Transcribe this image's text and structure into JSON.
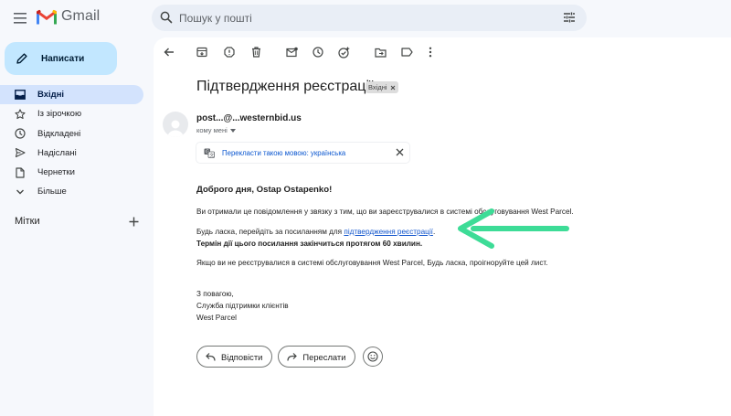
{
  "app": {
    "name": "Gmail"
  },
  "search": {
    "placeholder": "Пошук у пошті"
  },
  "compose": {
    "label": "Написати"
  },
  "sidebar": {
    "items": [
      {
        "label": "Вхідні",
        "icon": "inbox-icon",
        "active": true
      },
      {
        "label": "Із зірочкою",
        "icon": "star-icon"
      },
      {
        "label": "Відкладені",
        "icon": "clock-icon"
      },
      {
        "label": "Надіслані",
        "icon": "send-icon"
      },
      {
        "label": "Чернетки",
        "icon": "draft-icon"
      },
      {
        "label": "Більше",
        "icon": "chevron-down-icon"
      }
    ],
    "labels_title": "Мітки"
  },
  "message": {
    "subject": "Підтвердження реєстрації",
    "folder_chip": "Вхідні",
    "sender": "post...@...westernbid.us",
    "to": "кому мені",
    "translate_label": "Перекласти такою мовою: українська",
    "greeting": "Доброго дня, Ostap Ostapenko!",
    "para1": "Ви отримали це повідомлення у звязку з тим, що ви зареєструвалися в системі обслуговування West Parcel.",
    "para2_prefix": "Будь ласка, перейдіть за посиланням для ",
    "para2_link": "підтвердження реєстрації",
    "para2_suffix": ".",
    "para2_bold": "Термін дії цього посилання закінчиться протягом 60 хвилин.",
    "para3": "Якщо ви не реєструвалися в системі обслуговування West Parcel, Будь ласка, проігноруйте цей лист.",
    "sign1": "З повагою,",
    "sign2": "Служба підтримки клієнтів",
    "sign3": "West Parcel"
  },
  "actions": {
    "reply": "Відповісти",
    "forward": "Переслати"
  },
  "colors": {
    "accent_arrow": "#3ddc97",
    "compose_bg": "#c2e7ff",
    "active_nav": "#d3e3fd",
    "link": "#1155cc"
  }
}
